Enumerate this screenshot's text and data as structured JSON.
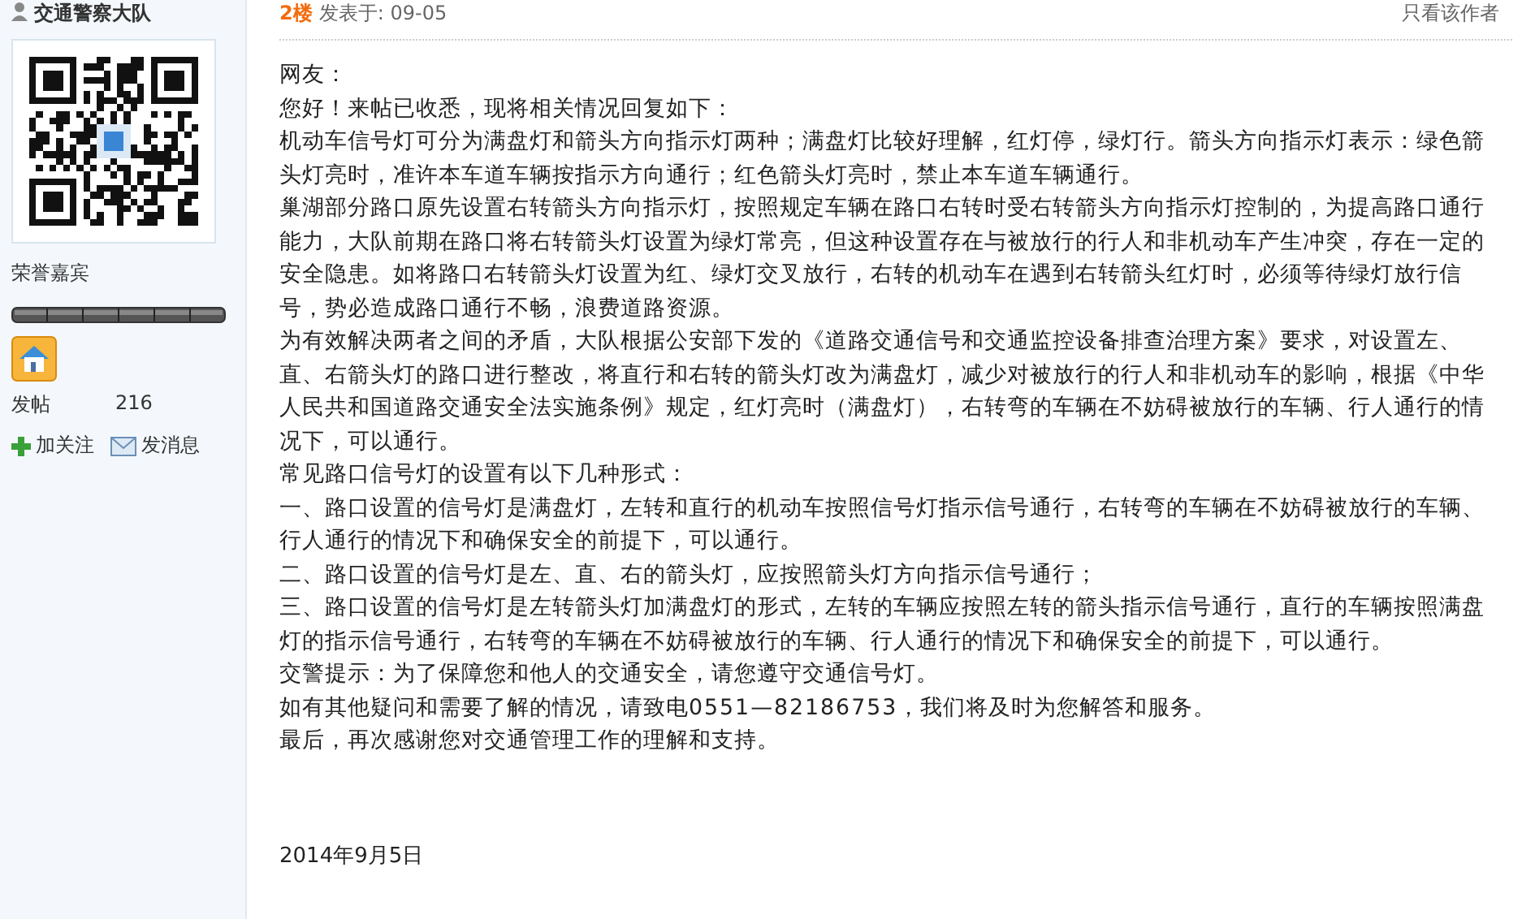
{
  "author": {
    "name": "交通警察大队",
    "honor": "荣誉嘉宾",
    "stats": [
      {
        "label": "发帖",
        "value": "216"
      }
    ],
    "actions": [
      {
        "kind": "follow",
        "label": "加关注"
      },
      {
        "kind": "message",
        "label": "发消息"
      }
    ]
  },
  "post": {
    "floor": "2楼",
    "posted": "发表于: 09-05",
    "author_only": "只看该作者",
    "paragraphs": [
      "网友：",
      "您好！来帖已收悉，现将相关情况回复如下：",
      "机动车信号灯可分为满盘灯和箭头方向指示灯两种；满盘灯比较好理解，红灯停，绿灯行。箭头方向指示灯表示：绿色箭头灯亮时，准许本车道车辆按指示方向通行；红色箭头灯亮时，禁止本车道车辆通行。",
      "巢湖部分路口原先设置右转箭头方向指示灯，按照规定车辆在路口右转时受右转箭头方向指示灯控制的，为提高路口通行能力，大队前期在路口将右转箭头灯设置为绿灯常亮，但这种设置存在与被放行的行人和非机动车产生冲突，存在一定的安全隐患。如将路口右转箭头灯设置为红、绿灯交叉放行，右转的机动车在遇到右转箭头红灯时，必须等待绿灯放行信号，势必造成路口通行不畅，浪费道路资源。",
      "为有效解决两者之间的矛盾，大队根据公安部下发的《道路交通信号和交通监控设备排查治理方案》要求，对设置左、直、右箭头灯的路口进行整改，将直行和右转的箭头灯改为满盘灯，减少对被放行的行人和非机动车的影响，根据《中华人民共和国道路交通安全法实施条例》规定，红灯亮时（满盘灯），右转弯的车辆在不妨碍被放行的车辆、行人通行的情况下，可以通行。",
      "常见路口信号灯的设置有以下几种形式：",
      "一、路口设置的信号灯是满盘灯，左转和直行的机动车按照信号灯指示信号通行，右转弯的车辆在不妨碍被放行的车辆、行人通行的情况下和确保安全的前提下，可以通行。",
      "二、路口设置的信号灯是左、直、右的箭头灯，应按照箭头灯方向指示信号通行；",
      "三、路口设置的信号灯是左转箭头灯加满盘灯的形式，左转的车辆应按照左转的箭头指示信号通行，直行的车辆按照满盘灯的指示信号通行，右转弯的车辆在不妨碍被放行的车辆、行人通行的情况下和确保安全的前提下，可以通行。",
      "交警提示：为了保障您和他人的交通安全，请您遵守交通信号灯。",
      "如有其他疑问和需要了解的情况，请致电0551—82186753，我们将及时为您解答和服务。",
      "最后，再次感谢您对交通管理工作的理解和支持。"
    ],
    "date": "2014年9月5日"
  }
}
